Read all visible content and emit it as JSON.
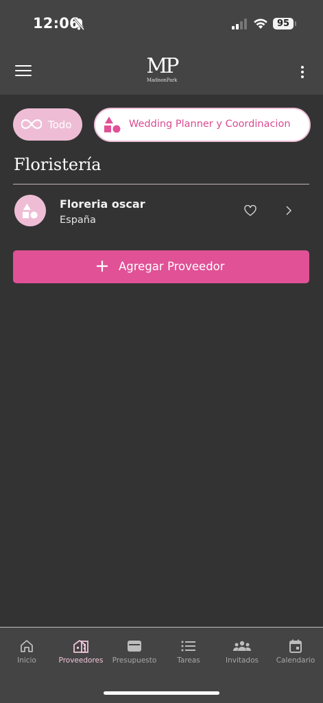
{
  "status": {
    "time": "12:06",
    "battery": "95"
  },
  "header": {
    "logo_mark": "MP",
    "logo_sub": "MadisonPark"
  },
  "filters": [
    {
      "label": "Todo",
      "icon": "infinity-icon"
    },
    {
      "label": "Wedding Planner y Coordinacion",
      "icon": "shapes-icon"
    }
  ],
  "section": {
    "title": "Floristería"
  },
  "vendor": {
    "name": "Floreria oscar",
    "country": "España"
  },
  "add_button": {
    "label": "Agregar Proveedor"
  },
  "nav": {
    "items": [
      {
        "label": "Inicio",
        "icon": "home-icon"
      },
      {
        "label": "Proveedores",
        "icon": "vendors-icon"
      },
      {
        "label": "Presupuesto",
        "icon": "wallet-icon"
      },
      {
        "label": "Tareas",
        "icon": "list-icon"
      },
      {
        "label": "Invitados",
        "icon": "guests-icon"
      },
      {
        "label": "Calendario",
        "icon": "calendar-icon"
      }
    ],
    "active": "Proveedores"
  },
  "colors": {
    "accent": "#e05196",
    "accent_light": "#eebdd5",
    "background": "#333333",
    "bar": "#444444"
  }
}
